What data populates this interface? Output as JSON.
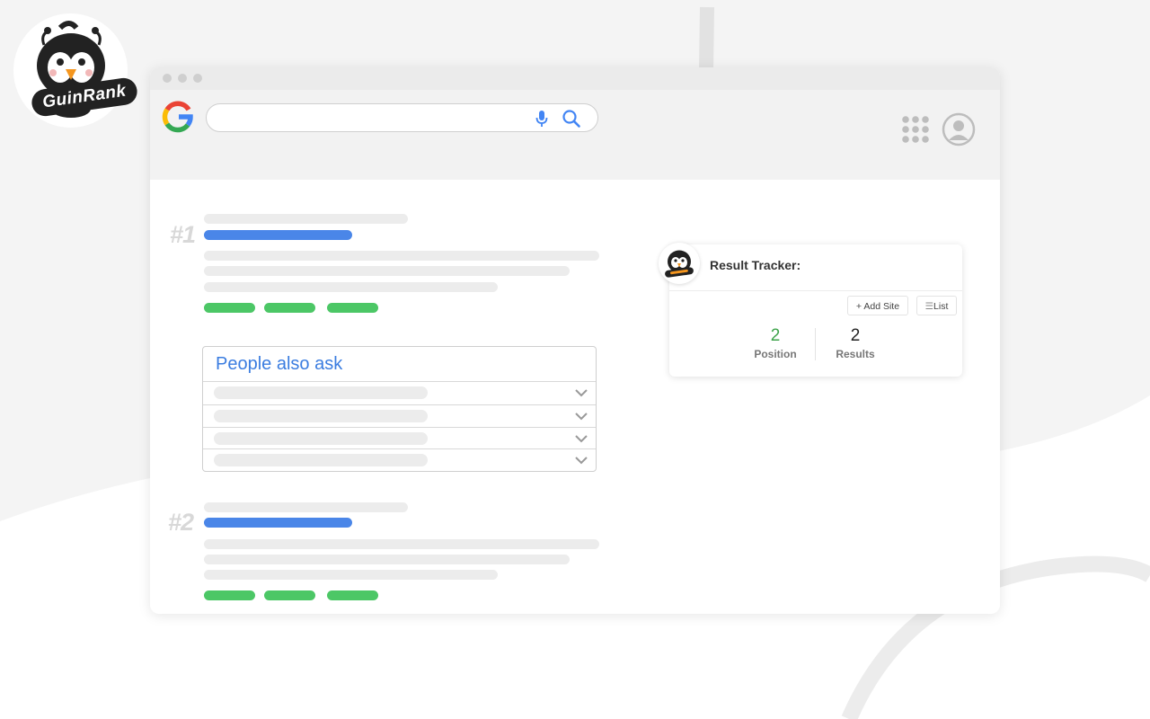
{
  "brand": {
    "logo_text": "GuinRank"
  },
  "browser": {
    "search": {
      "value": "",
      "placeholder": ""
    },
    "icons": {
      "engine_logo": "google-logo",
      "mic": "microphone-icon",
      "search": "magnifier-icon",
      "apps": "grid-icon",
      "account": "user-circle-icon"
    }
  },
  "results": [
    {
      "rank": "#1"
    },
    {
      "rank": "#2"
    }
  ],
  "people_also_ask": {
    "title": "People also ask",
    "question_count": 4
  },
  "tracker": {
    "title": "Result Tracker:",
    "add_site_label": "+ Add Site",
    "list_label": "List",
    "position_value": "2",
    "position_label": "Position",
    "results_value": "2",
    "results_label": "Results"
  },
  "colors": {
    "link_blue": "#4a86e8",
    "url_green": "#4cc766",
    "paa_title": "#3b7de0",
    "position_green": "#3da34a"
  }
}
